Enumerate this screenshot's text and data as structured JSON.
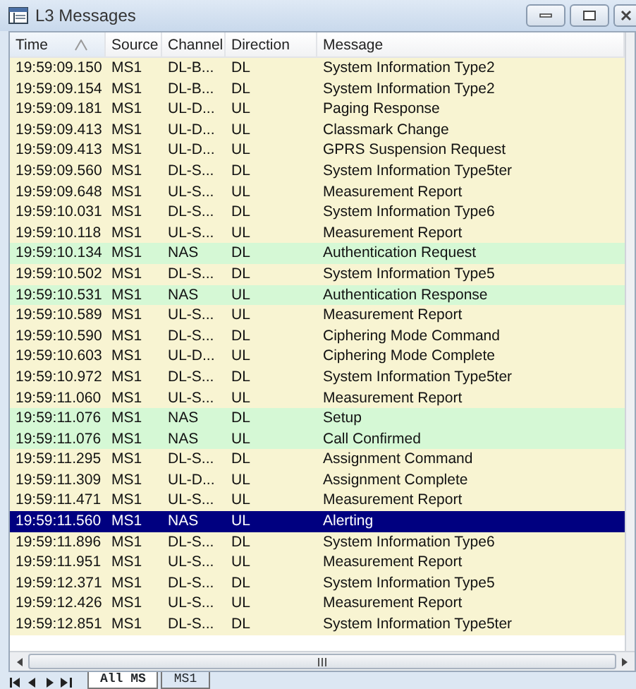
{
  "window": {
    "title": "L3 Messages"
  },
  "table": {
    "columns": [
      {
        "label": "Time",
        "sorted": true
      },
      {
        "label": "Source",
        "sorted": false
      },
      {
        "label": "Channel",
        "sorted": false
      },
      {
        "label": "Direction",
        "sorted": false
      },
      {
        "label": "Message",
        "sorted": false
      }
    ],
    "rows": [
      {
        "kind": "rr",
        "selected": false,
        "cells": [
          "19:59:09.150",
          "MS1",
          "DL-B...",
          "DL",
          "System Information Type2"
        ]
      },
      {
        "kind": "rr",
        "selected": false,
        "cells": [
          "19:59:09.154",
          "MS1",
          "DL-B...",
          "DL",
          "System Information Type2"
        ]
      },
      {
        "kind": "rr",
        "selected": false,
        "cells": [
          "19:59:09.181",
          "MS1",
          "UL-D...",
          "UL",
          "Paging Response"
        ]
      },
      {
        "kind": "rr",
        "selected": false,
        "cells": [
          "19:59:09.413",
          "MS1",
          "UL-D...",
          "UL",
          "Classmark Change"
        ]
      },
      {
        "kind": "rr",
        "selected": false,
        "cells": [
          "19:59:09.413",
          "MS1",
          "UL-D...",
          "UL",
          "GPRS Suspension Request"
        ]
      },
      {
        "kind": "rr",
        "selected": false,
        "cells": [
          "19:59:09.560",
          "MS1",
          "DL-S...",
          "DL",
          "System Information Type5ter"
        ]
      },
      {
        "kind": "rr",
        "selected": false,
        "cells": [
          "19:59:09.648",
          "MS1",
          "UL-S...",
          "UL",
          "Measurement Report"
        ]
      },
      {
        "kind": "rr",
        "selected": false,
        "cells": [
          "19:59:10.031",
          "MS1",
          "DL-S...",
          "DL",
          "System Information Type6"
        ]
      },
      {
        "kind": "rr",
        "selected": false,
        "cells": [
          "19:59:10.118",
          "MS1",
          "UL-S...",
          "UL",
          "Measurement Report"
        ]
      },
      {
        "kind": "nas",
        "selected": false,
        "cells": [
          "19:59:10.134",
          "MS1",
          "NAS",
          "DL",
          "Authentication Request"
        ]
      },
      {
        "kind": "rr",
        "selected": false,
        "cells": [
          "19:59:10.502",
          "MS1",
          "DL-S...",
          "DL",
          "System Information Type5"
        ]
      },
      {
        "kind": "nas",
        "selected": false,
        "cells": [
          "19:59:10.531",
          "MS1",
          "NAS",
          "UL",
          "Authentication Response"
        ]
      },
      {
        "kind": "rr",
        "selected": false,
        "cells": [
          "19:59:10.589",
          "MS1",
          "UL-S...",
          "UL",
          "Measurement Report"
        ]
      },
      {
        "kind": "rr",
        "selected": false,
        "cells": [
          "19:59:10.590",
          "MS1",
          "DL-S...",
          "DL",
          "Ciphering Mode Command"
        ]
      },
      {
        "kind": "rr",
        "selected": false,
        "cells": [
          "19:59:10.603",
          "MS1",
          "UL-D...",
          "UL",
          "Ciphering Mode Complete"
        ]
      },
      {
        "kind": "rr",
        "selected": false,
        "cells": [
          "19:59:10.972",
          "MS1",
          "DL-S...",
          "DL",
          "System Information Type5ter"
        ]
      },
      {
        "kind": "rr",
        "selected": false,
        "cells": [
          "19:59:11.060",
          "MS1",
          "UL-S...",
          "UL",
          "Measurement Report"
        ]
      },
      {
        "kind": "nas",
        "selected": false,
        "cells": [
          "19:59:11.076",
          "MS1",
          "NAS",
          "DL",
          "Setup"
        ]
      },
      {
        "kind": "nas",
        "selected": false,
        "cells": [
          "19:59:11.076",
          "MS1",
          "NAS",
          "UL",
          "Call Confirmed"
        ]
      },
      {
        "kind": "rr",
        "selected": false,
        "cells": [
          "19:59:11.295",
          "MS1",
          "DL-S...",
          "DL",
          "Assignment Command"
        ]
      },
      {
        "kind": "rr",
        "selected": false,
        "cells": [
          "19:59:11.309",
          "MS1",
          "UL-D...",
          "UL",
          "Assignment Complete"
        ]
      },
      {
        "kind": "rr",
        "selected": false,
        "cells": [
          "19:59:11.471",
          "MS1",
          "UL-S...",
          "UL",
          "Measurement Report"
        ]
      },
      {
        "kind": "nas",
        "selected": true,
        "cells": [
          "19:59:11.560",
          "MS1",
          "NAS",
          "UL",
          "Alerting"
        ]
      },
      {
        "kind": "rr",
        "selected": false,
        "cells": [
          "19:59:11.896",
          "MS1",
          "DL-S...",
          "DL",
          "System Information Type6"
        ]
      },
      {
        "kind": "rr",
        "selected": false,
        "cells": [
          "19:59:11.951",
          "MS1",
          "UL-S...",
          "UL",
          "Measurement Report"
        ]
      },
      {
        "kind": "rr",
        "selected": false,
        "cells": [
          "19:59:12.371",
          "MS1",
          "DL-S...",
          "DL",
          "System Information Type5"
        ]
      },
      {
        "kind": "rr",
        "selected": false,
        "cells": [
          "19:59:12.426",
          "MS1",
          "UL-S...",
          "UL",
          "Measurement Report"
        ]
      },
      {
        "kind": "rr",
        "selected": false,
        "cells": [
          "19:59:12.851",
          "MS1",
          "DL-S...",
          "DL",
          "System Information Type5ter"
        ]
      }
    ]
  },
  "tabs": [
    {
      "label": "All MS",
      "selected": true
    },
    {
      "label": "MS1",
      "selected": false
    }
  ]
}
